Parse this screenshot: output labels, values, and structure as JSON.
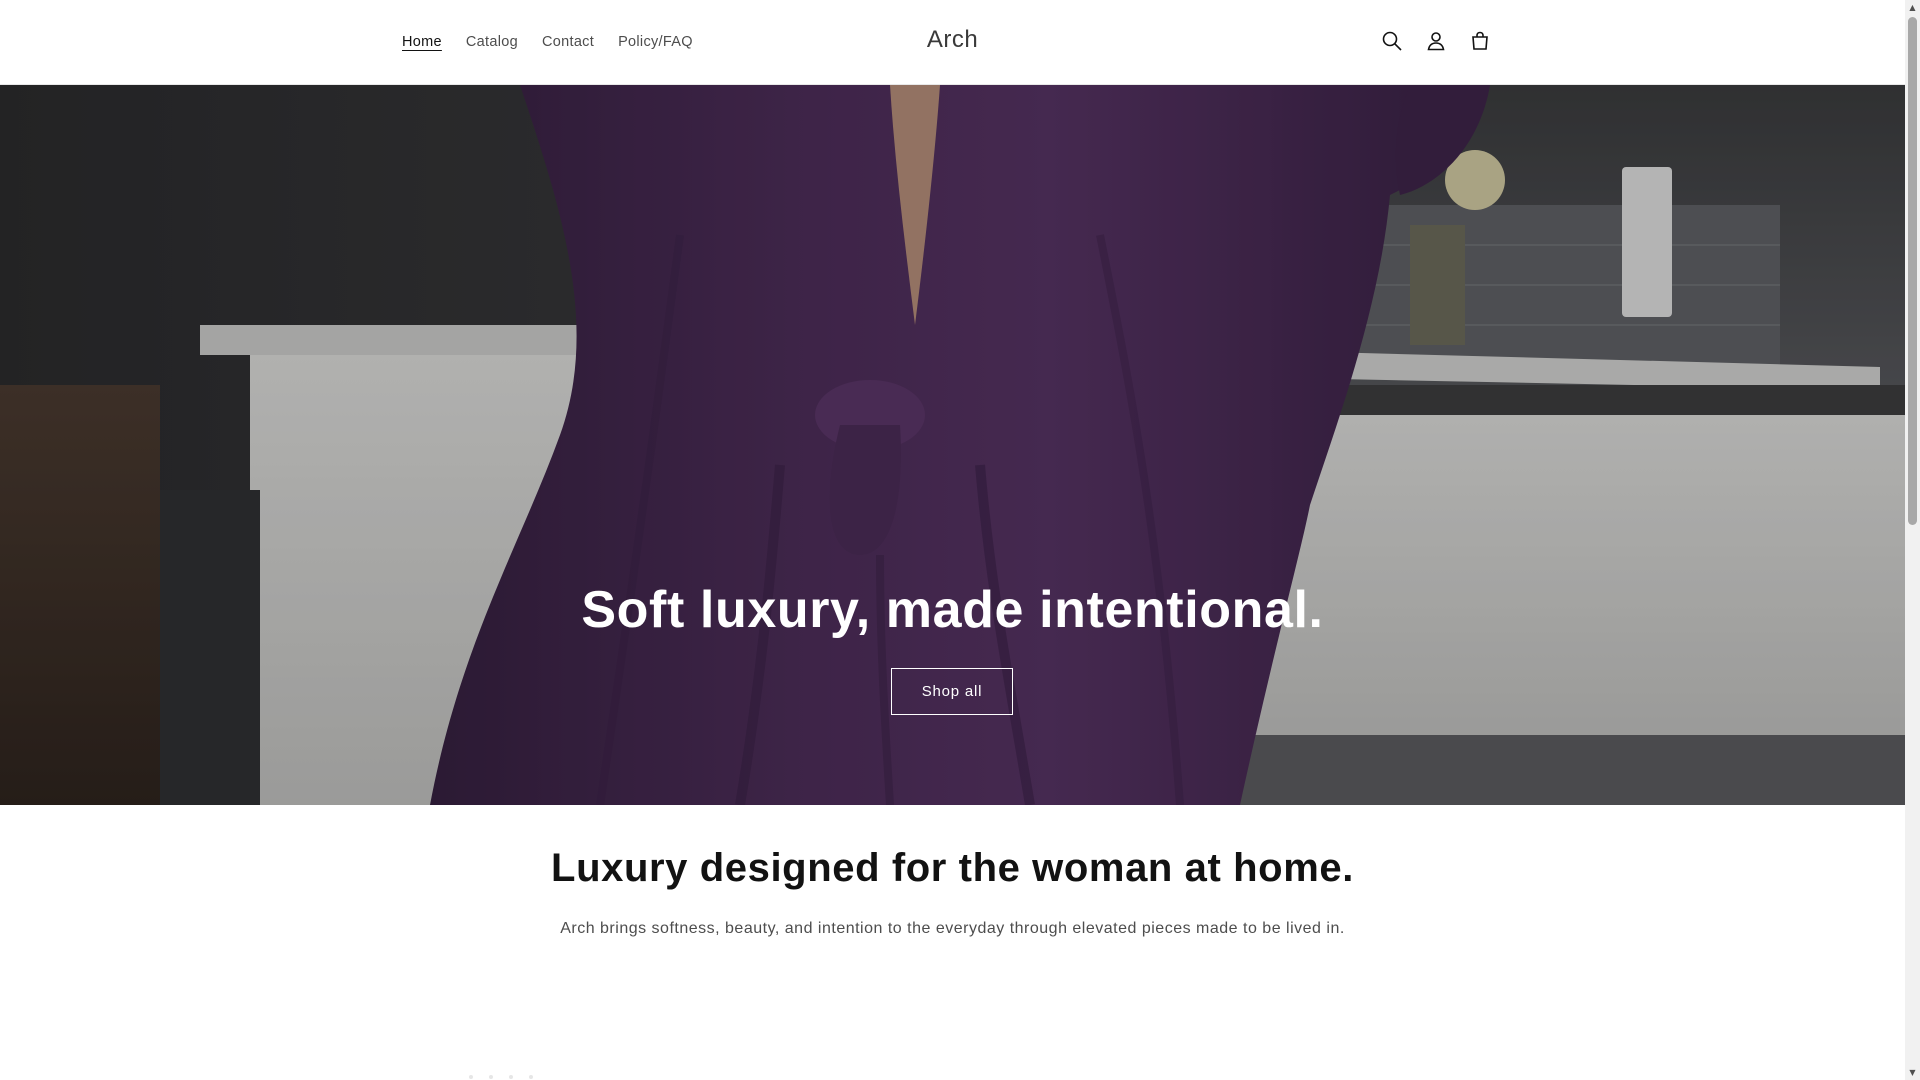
{
  "header": {
    "nav": [
      {
        "label": "Home",
        "active": true
      },
      {
        "label": "Catalog",
        "active": false
      },
      {
        "label": "Contact",
        "active": false
      },
      {
        "label": "Policy/FAQ",
        "active": false
      }
    ],
    "brand": "Arch",
    "icons": [
      "search-icon",
      "account-icon",
      "cart-icon"
    ]
  },
  "hero": {
    "title": "Soft luxury, made intentional.",
    "button_label": "Shop all"
  },
  "intro": {
    "heading": "Luxury designed for the woman at home.",
    "text": "Arch brings softness, beauty, and intention to the everyday through elevated pieces made to be lived in."
  },
  "colors": {
    "dress": "#4a2a55",
    "text_dark": "#121212",
    "text_muted": "#4d4d4d"
  }
}
